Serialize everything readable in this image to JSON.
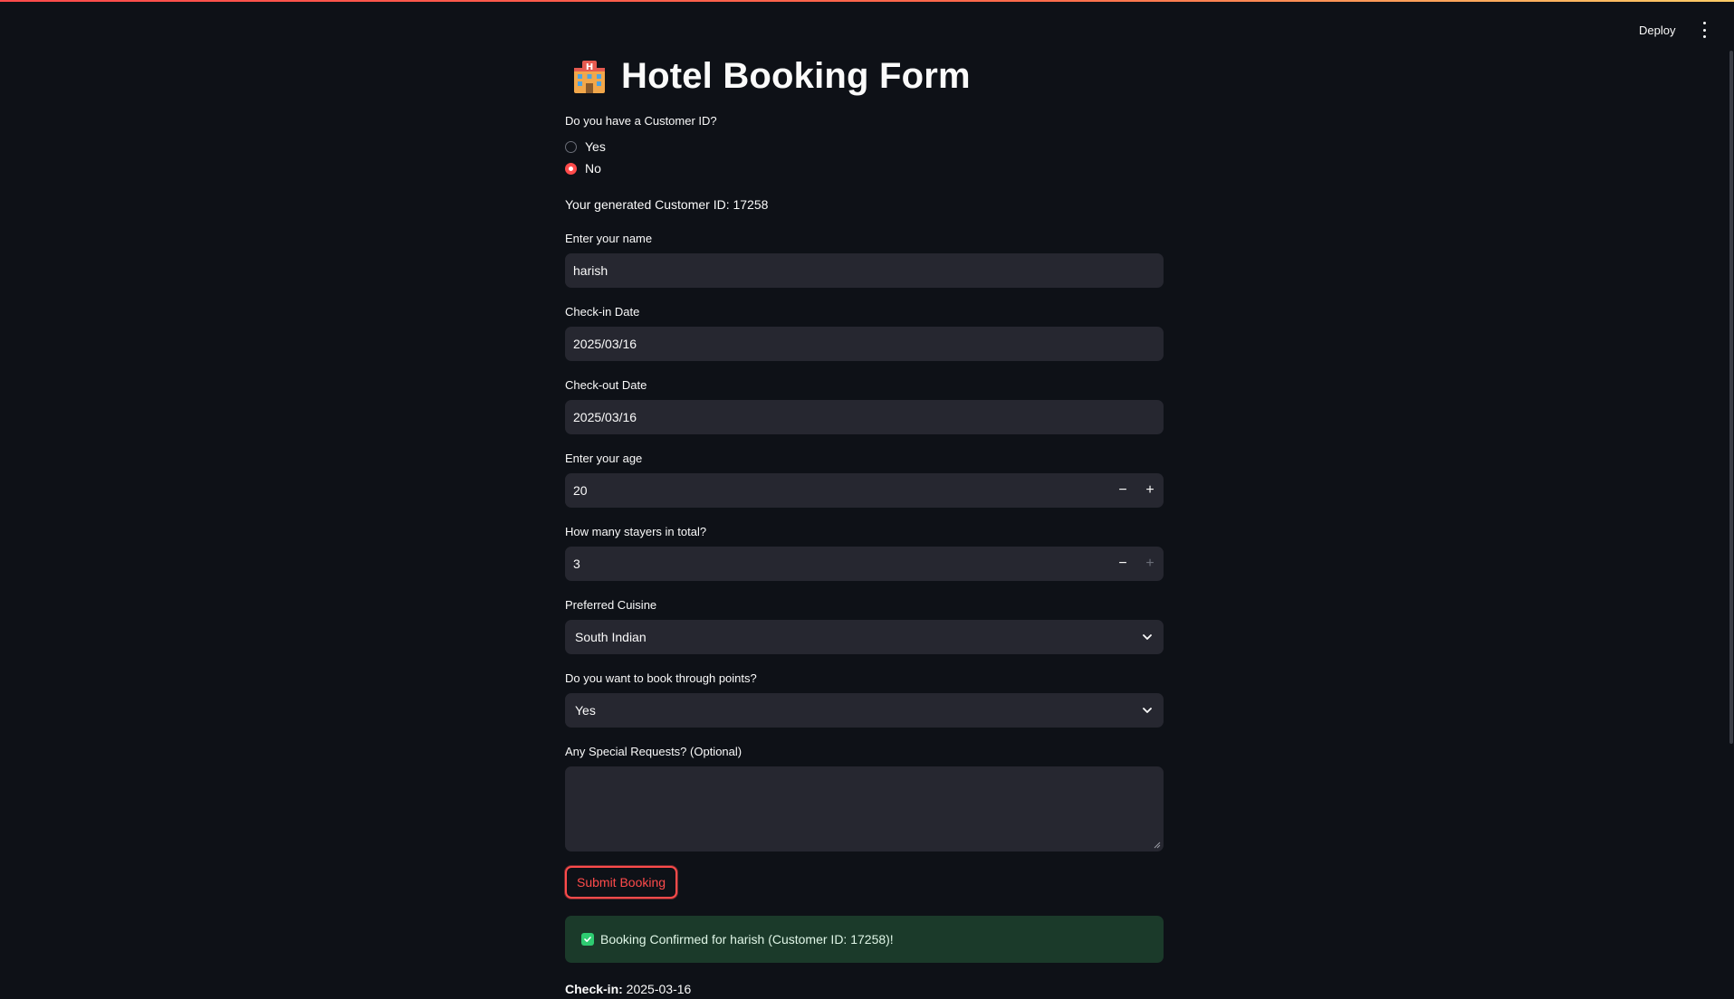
{
  "header": {
    "deploy_label": "Deploy"
  },
  "page": {
    "title": "Hotel Booking Form"
  },
  "customer_id_question": {
    "label": "Do you have a Customer ID?",
    "options": [
      "Yes",
      "No"
    ],
    "selected": "No"
  },
  "generated_id_text": "Your generated Customer ID: 17258",
  "name_field": {
    "label": "Enter your name",
    "value": "harish"
  },
  "checkin_field": {
    "label": "Check-in Date",
    "value": "2025/03/16"
  },
  "checkout_field": {
    "label": "Check-out Date",
    "value": "2025/03/16"
  },
  "age_field": {
    "label": "Enter your age",
    "value": "20",
    "minus": "−",
    "plus": "+"
  },
  "stayers_field": {
    "label": "How many stayers in total?",
    "value": "3",
    "minus": "−",
    "plus": "+"
  },
  "cuisine_field": {
    "label": "Preferred Cuisine",
    "value": "South Indian"
  },
  "points_field": {
    "label": "Do you want to book through points?",
    "value": "Yes"
  },
  "requests_field": {
    "label": "Any Special Requests? (Optional)",
    "value": ""
  },
  "submit_label": "Submit Booking",
  "success_message": "Booking Confirmed for harish (Customer ID: 17258)!",
  "summary": {
    "checkin_label": "Check-in:",
    "checkin_value": " 2025-03-16"
  },
  "colors": {
    "background": "#0e1117",
    "accent": "#ff4b4b",
    "input_bg": "#262730",
    "success_bg": "#1b3a2a",
    "success_icon": "#2ecc71"
  },
  "icons": {
    "title": "hotel-icon",
    "menu": "kebab-menu-icon",
    "chevron": "chevron-down-icon",
    "success": "check-box-icon"
  }
}
